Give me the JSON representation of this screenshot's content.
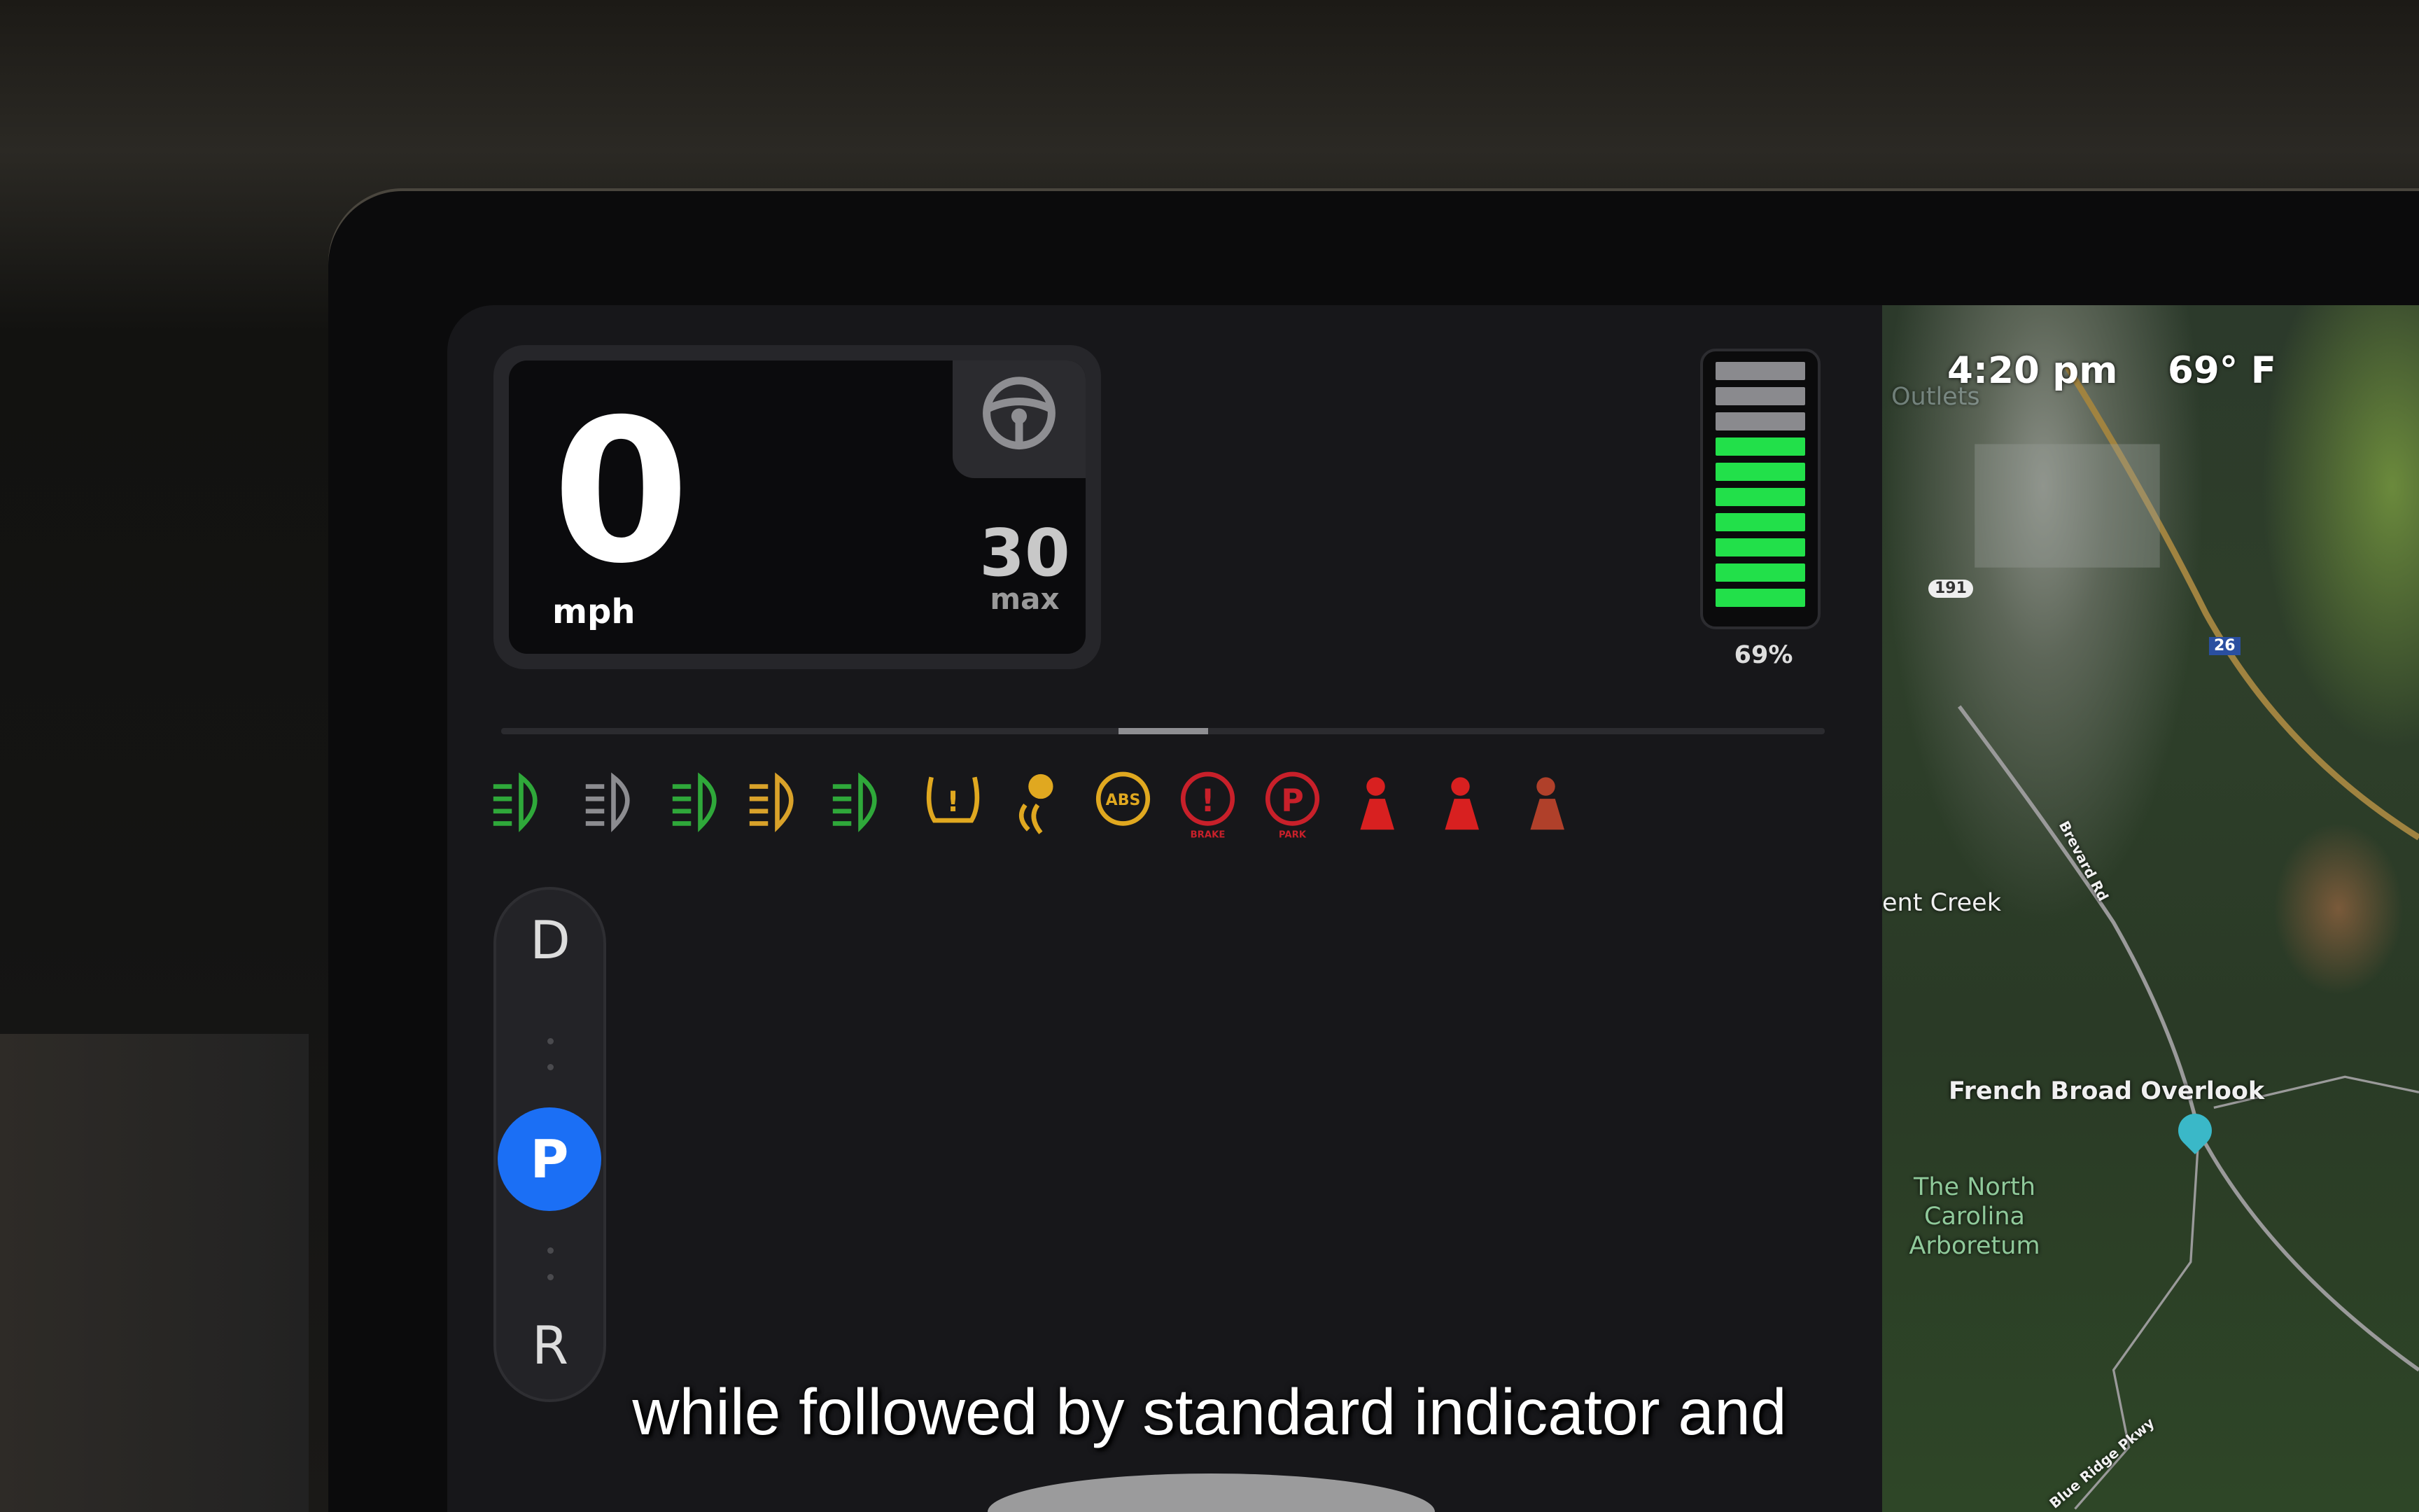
{
  "speed": {
    "value": "0",
    "unit": "mph",
    "limit": "30",
    "limit_label": "max"
  },
  "battery": {
    "percent_label": "69%",
    "level": 0.69,
    "segments_total": 10,
    "segments_filled": 7,
    "fill_color": "#22e04a",
    "empty_color": "#8a8a8e"
  },
  "indicators": [
    {
      "name": "low-beam-icon",
      "color": "#2fa83a"
    },
    {
      "name": "auto-headlight-icon",
      "color": "#8c8c90"
    },
    {
      "name": "front-fog-light-icon",
      "color": "#2fa83a"
    },
    {
      "name": "rear-fog-light-icon",
      "color": "#d9a22a"
    },
    {
      "name": "parking-lights-icon",
      "color": "#2fa83a"
    },
    {
      "name": "tire-pressure-warning-icon",
      "color": "#e0a820"
    },
    {
      "name": "traction-control-icon",
      "color": "#e0a820"
    },
    {
      "name": "abs-warning-icon",
      "color": "#e0a820",
      "label": "ABS"
    },
    {
      "name": "brake-warning-icon",
      "color": "#c8202a",
      "label": "BRAKE"
    },
    {
      "name": "parking-brake-icon",
      "color": "#c8202a",
      "label": "PARK"
    },
    {
      "name": "seatbelt-warning-icon",
      "color": "#d82020"
    },
    {
      "name": "airbag-warning-icon",
      "color": "#d82020"
    },
    {
      "name": "occupant-sensor-icon",
      "color": "#b0402a"
    }
  ],
  "gear": {
    "options": [
      "D",
      "P",
      "R"
    ],
    "selected": "P",
    "accent": "#1b6ff5"
  },
  "map": {
    "time": "4:20 pm",
    "temperature": "69° F",
    "labels": {
      "outlets": "Outlets",
      "route_191": "191",
      "route_26": "26",
      "creek": "ent Creek",
      "road": "Brevard Rd",
      "overlook": "French Broad Overlook",
      "arboretum": "The North Carolina Arboretum",
      "parkway": "Blue Ridge Pkwy"
    }
  },
  "subtitle": "while followed by standard indicator and"
}
